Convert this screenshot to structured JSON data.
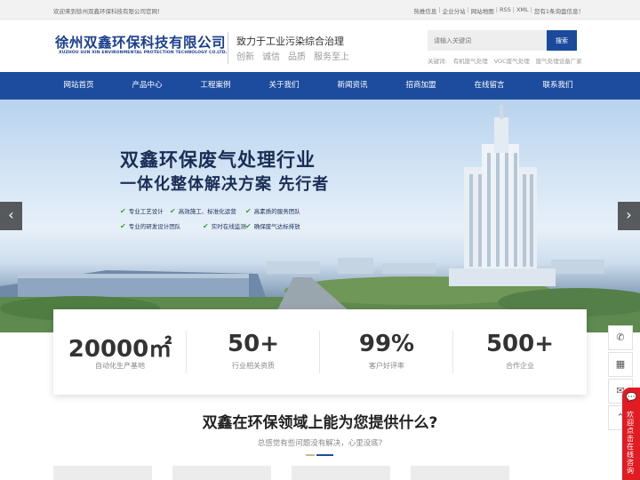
{
  "topbar": {
    "welcome": "欢迎来到徐州双鑫环保科技有限公司官网！",
    "links": [
      "热推信息",
      "企业分站",
      "网站地图",
      "RSS",
      "XML",
      "您有1条询盘信息！"
    ]
  },
  "header": {
    "company_name": "徐州双鑫环保科技有限公司",
    "company_name_en": "XUZHOU SUN XIN ENVIRONMENTAL PROTECTION TECHNOLOGY CO.LTD.",
    "slogan": "致力于工业污染综合治理",
    "values": [
      "创新",
      "诚信",
      "品质",
      "服务至上"
    ],
    "search_placeholder": "请输入关键词",
    "search_button": "搜索",
    "hotwords_label": "关键词:",
    "hotwords": [
      "有机废气处理",
      "VOC废气处理",
      "废气处理设备厂家"
    ]
  },
  "nav": {
    "items": [
      "网站首页",
      "产品中心",
      "工程案例",
      "关于我们",
      "新闻资讯",
      "招商加盟",
      "在线留言",
      "联系我们"
    ]
  },
  "banner": {
    "headline_1": "双鑫环保废气处理行业",
    "headline_2": "一体化整体解决方案 先行者",
    "features": [
      "专业工艺设计",
      "高效施工、标准化运营",
      "高素质的服务团队",
      "专业的研发设计团队",
      "实时在线监测",
      "确保废气达标排放"
    ],
    "prev": "‹",
    "next": "›"
  },
  "stats": [
    {
      "num": "20000㎡",
      "label": "自动化生产基地"
    },
    {
      "num": "50+",
      "label": "行业相关资质"
    },
    {
      "num": "99%",
      "label": "客户好评率"
    },
    {
      "num": "500+",
      "label": "合作企业"
    }
  ],
  "section": {
    "title": "双鑫在环保领域上能为您提供什么?",
    "subtitle": "总感觉有些问题没有解决，心里没底?"
  },
  "side_tools": {
    "phone_icon": "✆",
    "qr_icon": "▦",
    "msg_icon": "✉",
    "top_icon": "⌃"
  },
  "chat": {
    "icon": "💬",
    "label": "欢迎点击在线咨询"
  },
  "colors": {
    "brand_blue": "#1d4c9e",
    "headline": "#1a2d55",
    "check_green": "#3aa13b",
    "chat_red": "#e01b22",
    "divider_gold": "#d2b48c"
  }
}
